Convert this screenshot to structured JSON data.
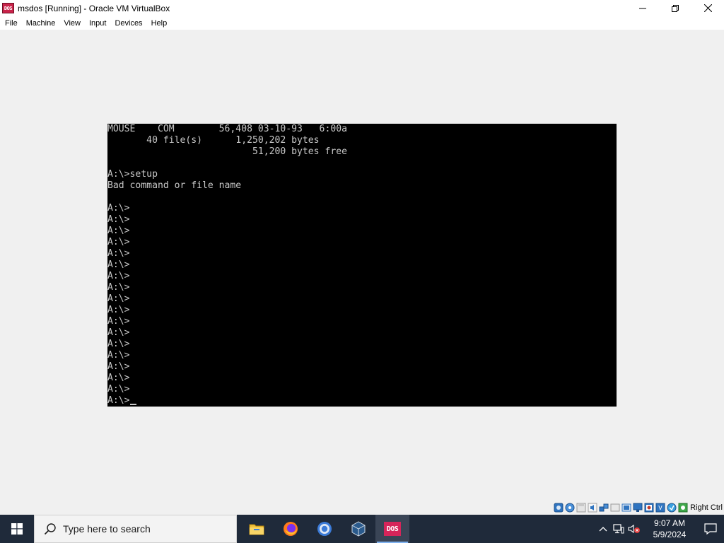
{
  "window": {
    "title": "msdos [Running] - Oracle VM VirtualBox",
    "icon_label": "DOS",
    "controls": [
      "minimize-icon",
      "maximize-icon",
      "close-icon"
    ]
  },
  "menu": [
    {
      "label": "File"
    },
    {
      "label": "Machine"
    },
    {
      "label": "View"
    },
    {
      "label": "Input"
    },
    {
      "label": "Devices"
    },
    {
      "label": "Help"
    }
  ],
  "dos": {
    "lines": [
      "MOUSE    COM        56,408 03-10-93   6:00a",
      "       40 file(s)      1,250,202 bytes",
      "                          51,200 bytes free",
      "",
      "A:\\>setup",
      "Bad command or file name",
      "",
      "A:\\>",
      "A:\\>",
      "A:\\>",
      "A:\\>",
      "A:\\>",
      "A:\\>",
      "A:\\>",
      "A:\\>",
      "A:\\>",
      "A:\\>",
      "A:\\>",
      "A:\\>",
      "A:\\>",
      "A:\\>",
      "A:\\>",
      "A:\\>",
      "A:\\>",
      "A:\\>"
    ],
    "colors": {
      "background": "#000000",
      "text": "#c8c8c8"
    }
  },
  "status": {
    "indicators": [
      "hard-disk-icon",
      "optical-drive-icon",
      "floppy-icon",
      "audio-icon",
      "network-icon",
      "usb-icon",
      "shared-folder-icon",
      "display-icon",
      "recording-icon",
      "cpu-icon",
      "mouse-integration-icon",
      "keyboard-icon"
    ],
    "host_key": "Right Ctrl"
  },
  "taskbar": {
    "search_placeholder": "Type here to search",
    "apps": [
      {
        "name": "file-explorer-icon",
        "active": false
      },
      {
        "name": "firefox-icon",
        "active": false
      },
      {
        "name": "chrome-icon",
        "active": false
      },
      {
        "name": "virtualbox-icon",
        "active": false
      },
      {
        "name": "dos-app-icon",
        "active": true,
        "label": "DOS"
      }
    ],
    "clock": {
      "time": "9:07 AM",
      "date": "5/9/2024"
    },
    "tray": [
      "chevron-up-icon",
      "network-icon",
      "volume-muted-icon",
      "notification-icon"
    ]
  },
  "colors": {
    "taskbar": "#1f2a3a",
    "accent": "#7fb2f0",
    "title_icon": "#c9234a"
  }
}
